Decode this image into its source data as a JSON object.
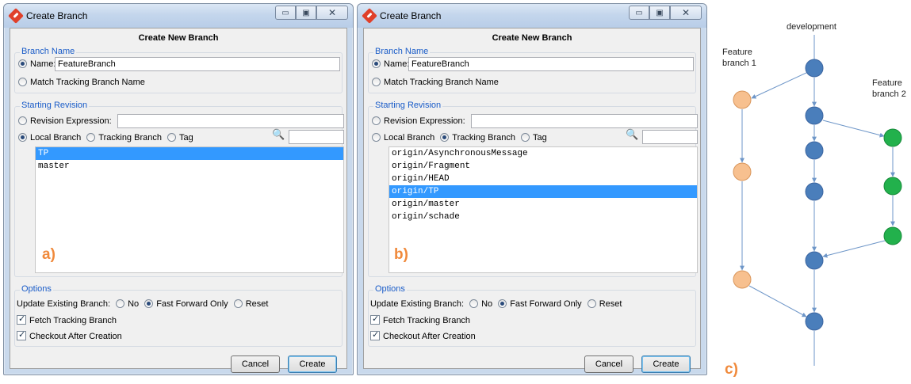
{
  "dialogs": [
    {
      "panel_label": "a)",
      "window_title": "Create Branch",
      "heading": "Create New Branch",
      "branch_name_group": "Branch Name",
      "name_label": "Name:",
      "name_value": "FeatureBranch",
      "match_tracking_label": "Match Tracking Branch Name",
      "starting_revision_group": "Starting Revision",
      "revision_expression_label": "Revision Expression:",
      "local_branch_label": "Local Branch",
      "tracking_branch_label": "Tracking Branch",
      "tag_label": "Tag",
      "selected_source": "local",
      "branches": [
        "TP",
        "master"
      ],
      "selected_index": 0,
      "options_group": "Options",
      "update_existing_label": "Update Existing Branch:",
      "opt_no": "No",
      "opt_ff": "Fast Forward Only",
      "opt_reset": "Reset",
      "fetch_tracking_label": "Fetch Tracking Branch",
      "checkout_label": "Checkout After Creation",
      "cancel_label": "Cancel",
      "create_label": "Create"
    },
    {
      "panel_label": "b)",
      "window_title": "Create Branch",
      "heading": "Create New Branch",
      "branch_name_group": "Branch Name",
      "name_label": "Name:",
      "name_value": "FeatureBranch",
      "match_tracking_label": "Match Tracking Branch Name",
      "starting_revision_group": "Starting Revision",
      "revision_expression_label": "Revision Expression:",
      "local_branch_label": "Local Branch",
      "tracking_branch_label": "Tracking Branch",
      "tag_label": "Tag",
      "selected_source": "tracking",
      "branches": [
        "origin/AsynchronousMessage",
        "origin/Fragment",
        "origin/HEAD",
        "origin/TP",
        "origin/master",
        "origin/schade"
      ],
      "selected_index": 3,
      "options_group": "Options",
      "update_existing_label": "Update Existing Branch:",
      "opt_no": "No",
      "opt_ff": "Fast Forward Only",
      "opt_reset": "Reset",
      "fetch_tracking_label": "Fetch Tracking Branch",
      "checkout_label": "Checkout After Creation",
      "cancel_label": "Cancel",
      "create_label": "Create"
    }
  ],
  "diagram": {
    "panel_label": "c)",
    "development_label": "development",
    "feature1_label": [
      "Feature",
      "branch 1"
    ],
    "feature2_label": [
      "Feature",
      "branch 2"
    ],
    "colors": {
      "development": "#4a7ebb",
      "feature1": "#f7c08f",
      "feature2": "#22b14c",
      "line": "#6e96c8"
    }
  }
}
